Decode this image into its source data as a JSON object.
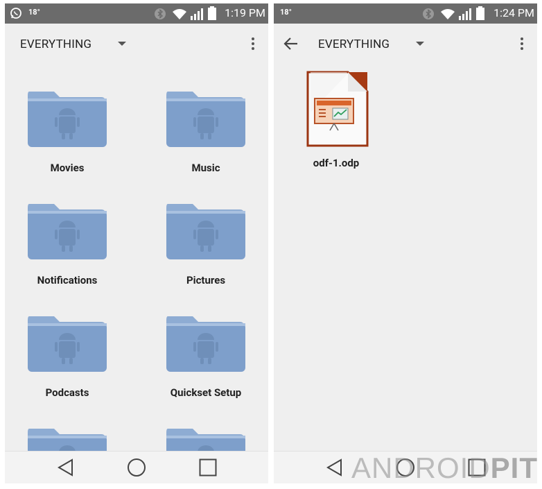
{
  "left": {
    "status": {
      "temp": "18°",
      "time": "1:19 PM"
    },
    "toolbar": {
      "title": "EVERYTHING"
    },
    "folders": [
      "Movies",
      "Music",
      "Notifications",
      "Pictures",
      "Podcasts",
      "Quickset Setup",
      "",
      ""
    ]
  },
  "right": {
    "status": {
      "temp": "18°",
      "time": "1:24 PM"
    },
    "toolbar": {
      "title": "EVERYTHING"
    },
    "file": {
      "name": "odf-1.odp",
      "icon": "presentation-file-icon"
    }
  },
  "watermark": {
    "text_light": "ANDROID",
    "text_bold": "PIT"
  },
  "colors": {
    "statusbar": "#6b6b6b",
    "background": "#efefef",
    "folder": "#7e9fcb",
    "accent": "#b03b16"
  }
}
